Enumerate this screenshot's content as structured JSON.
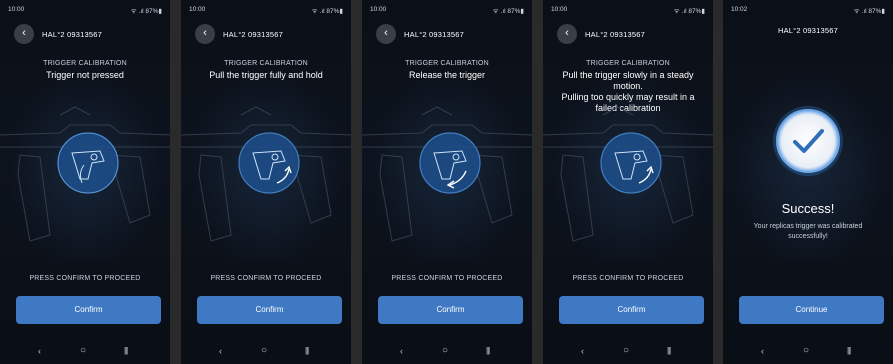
{
  "screens": [
    {
      "time": "10:00",
      "status_icons": "ᯤ .ıl 87%▮",
      "device": "HAL°2 09313567",
      "calibration_label": "TRIGGER CALIBRATION",
      "instruction": "Trigger not pressed",
      "proceed_text": "PRESS CONFIRM TO PROCEED",
      "button": "Confirm"
    },
    {
      "time": "10:00",
      "status_icons": "ᯤ .ıl 87%▮",
      "device": "HAL°2 09313567",
      "calibration_label": "TRIGGER CALIBRATION",
      "instruction": "Pull the trigger fully and hold",
      "proceed_text": "PRESS CONFIRM TO PROCEED",
      "button": "Confirm"
    },
    {
      "time": "10:00",
      "status_icons": "ᯤ .ıl 87%▮",
      "device": "HAL°2 09313567",
      "calibration_label": "TRIGGER CALIBRATION",
      "instruction": "Release the trigger",
      "proceed_text": "PRESS CONFIRM TO PROCEED",
      "button": "Confirm"
    },
    {
      "time": "10:00",
      "status_icons": "ᯤ .ıl 87%▮",
      "device": "HAL°2 09313567",
      "calibration_label": "TRIGGER CALIBRATION",
      "instruction": "Pull the trigger slowly in a steady motion.\nPulling too quickly may result in a failed calibration",
      "proceed_text": "PRESS CONFIRM TO PROCEED",
      "button": "Confirm"
    },
    {
      "time": "10:02",
      "status_icons": "ᯤ .ıl 87%▮",
      "device": "HAL°2 09313567",
      "success_title": "Success!",
      "success_message": "Your replicas trigger was calibrated successfully!",
      "button": "Continue"
    }
  ],
  "nav_icons": {
    "back": "‹",
    "home": "○",
    "recent": "|||"
  },
  "back_icon": "‹",
  "colors": {
    "accent": "#3f78c3",
    "background": "#0b0f17",
    "highlight": "#2f6fb8"
  }
}
